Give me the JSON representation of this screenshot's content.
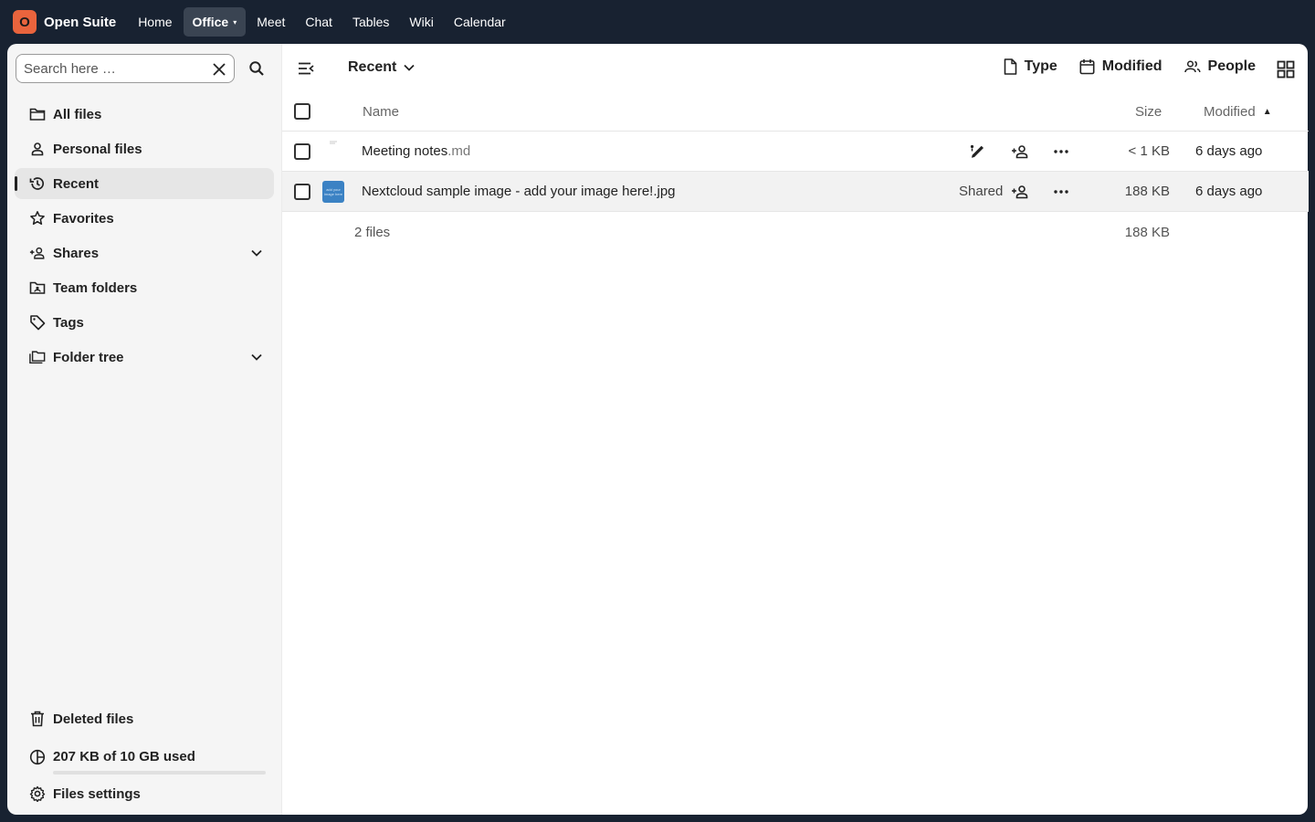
{
  "app": {
    "brand_initial": "O",
    "brand_name": "Open Suite",
    "accent_color": "#e9643d",
    "topbar_color": "#182231"
  },
  "topnav": {
    "items": [
      {
        "label": "Home",
        "active": false
      },
      {
        "label": "Office",
        "active": true,
        "has_dropdown": true
      },
      {
        "label": "Meet",
        "active": false
      },
      {
        "label": "Chat",
        "active": false
      },
      {
        "label": "Tables",
        "active": false
      },
      {
        "label": "Wiki",
        "active": false
      },
      {
        "label": "Calendar",
        "active": false
      }
    ]
  },
  "sidebar": {
    "search_placeholder": "Search here …",
    "items": [
      {
        "label": "All files",
        "icon": "folder-icon"
      },
      {
        "label": "Personal files",
        "icon": "person-icon"
      },
      {
        "label": "Recent",
        "icon": "history-icon",
        "active": true
      },
      {
        "label": "Favorites",
        "icon": "star-icon"
      },
      {
        "label": "Shares",
        "icon": "share-person-icon",
        "expandable": true
      },
      {
        "label": "Team folders",
        "icon": "team-folder-icon"
      },
      {
        "label": "Tags",
        "icon": "tag-icon"
      },
      {
        "label": "Folder tree",
        "icon": "folder-tree-icon",
        "expandable": true
      }
    ],
    "bottom": {
      "deleted": "Deleted files",
      "quota_text": "207 KB of 10 GB used",
      "quota_fraction": 0.0,
      "settings": "Files settings"
    }
  },
  "main": {
    "view_title": "Recent",
    "filters": {
      "type": "Type",
      "modified": "Modified",
      "people": "People"
    },
    "columns": {
      "name": "Name",
      "size": "Size",
      "modified": "Modified"
    },
    "files": [
      {
        "basename": "Meeting notes",
        "extension": ".md",
        "shared_label": "",
        "size": "< 1 KB",
        "modified": "6 days ago",
        "thumb": "document"
      },
      {
        "basename": "Nextcloud sample image - add your image here!.jpg",
        "extension": "",
        "shared_label": "Shared",
        "size": "188 KB",
        "modified": "6 days ago",
        "thumb": "image",
        "thumb_text": "add your image here"
      }
    ],
    "summary": {
      "count": "2 files",
      "size": "188 KB"
    }
  }
}
